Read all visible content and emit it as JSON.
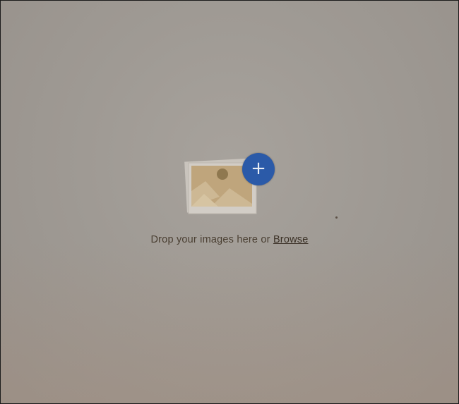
{
  "drop_zone": {
    "message": "Drop your images here or",
    "browse_label": "Browse"
  },
  "upload_icon": {
    "icon": "image-icon",
    "badge_icon": "plus-icon",
    "badge_glyph": "+",
    "badge_color": "#2b5aa8",
    "image_color": "#b9a07a"
  }
}
